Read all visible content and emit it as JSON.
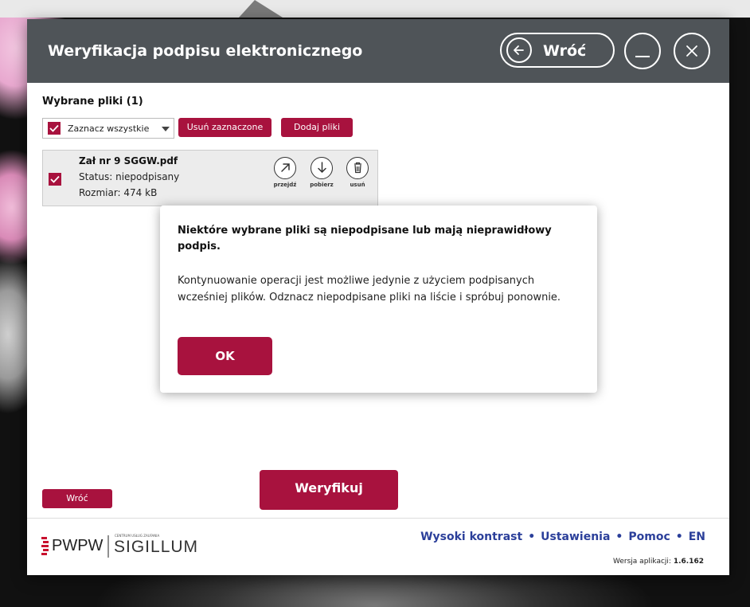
{
  "window": {
    "title": "Weryfikacja podpisu elektronicznego",
    "back_label": "Wróć"
  },
  "files": {
    "section_label": "Wybrane pliki",
    "count_label": "(1)",
    "select_all_label": "Zaznacz wszystkie",
    "remove_selected_label": "Usuń zaznaczone",
    "add_files_label": "Dodaj pliki",
    "items": [
      {
        "name": "Zał nr 9 SGGW.pdf",
        "status": "Status: niepodpisany",
        "size": "Rozmiar: 474 kB",
        "actions": [
          "przejdź",
          "pobierz",
          "usuń"
        ]
      }
    ]
  },
  "bottom": {
    "back_label": "Wróć",
    "verify_label": "Weryfikuj"
  },
  "footer": {
    "logo_pwpw": "PWPW",
    "logo_small": "CENTRUM USŁUG ZAUFANIA",
    "logo_sigillum": "SIGILLUM",
    "links": [
      "Wysoki kontrast",
      "Ustawienia",
      "Pomoc",
      "EN"
    ],
    "version_label": "Wersja aplikacji:",
    "version_value": "1.6.162"
  },
  "dialog": {
    "title": "Niektóre wybrane pliki są niepodpisane lub mają nieprawidłowy podpis.",
    "body": "Kontynuowanie operacji jest możliwe jedynie z użyciem podpisanych wcześniej plików. Odznacz niepodpisane pliki na liście i spróbuj ponownie.",
    "ok_label": "OK"
  },
  "colors": {
    "accent": "#a8123e",
    "titlebar": "#4f5458",
    "link": "#2b3f9a"
  }
}
